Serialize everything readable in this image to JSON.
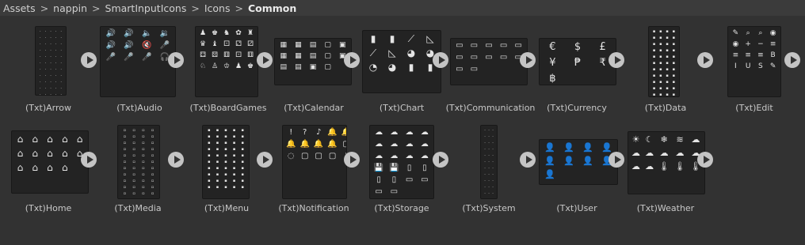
{
  "breadcrumb": [
    "Assets",
    "nappin",
    "SmartInputIcons",
    "Icons",
    "Common"
  ],
  "breadcrumb_separator": ">",
  "assets": [
    {
      "label": "(Txt)Arrow",
      "icon": "arrow-icon"
    },
    {
      "label": "(Txt)Audio",
      "icon": "audio-icon"
    },
    {
      "label": "(Txt)BoardGames",
      "icon": "board-games-icon"
    },
    {
      "label": "(Txt)Calendar",
      "icon": "calendar-icon"
    },
    {
      "label": "(Txt)Chart",
      "icon": "chart-icon"
    },
    {
      "label": "(Txt)Communication",
      "icon": "communication-icon"
    },
    {
      "label": "(Txt)Currency",
      "icon": "currency-icon"
    },
    {
      "label": "(Txt)Data",
      "icon": "data-icon"
    },
    {
      "label": "(Txt)Edit",
      "icon": "edit-icon"
    },
    {
      "label": "(Txt)Home",
      "icon": "home-icon"
    },
    {
      "label": "(Txt)Media",
      "icon": "media-icon"
    },
    {
      "label": "(Txt)Menu",
      "icon": "menu-icon"
    },
    {
      "label": "(Txt)Notification",
      "icon": "notification-icon"
    },
    {
      "label": "(Txt)Storage",
      "icon": "storage-icon"
    },
    {
      "label": "(Txt)System",
      "icon": "system-icon"
    },
    {
      "label": "(Txt)User",
      "icon": "user-icon"
    },
    {
      "label": "(Txt)Weather",
      "icon": "weather-icon"
    }
  ],
  "glyphs": {
    "arrow": "·",
    "audio": "🔊🔊🔈🔉🔊🔊🔇🎤🎤🎤🎤🎧",
    "boardgames": "♟♚♞✿♜♛♝⚀⚁⚂⚃⚄⚅⚀⚅♘♙♔",
    "calendar": "▦▦▤▢▣▦▦▤▢▣▤▤▣▢",
    "chart": "▮▮⟋◺⟋◺◕◕◔◕▮▮",
    "communication": "▭▭▭▭▭▭▭▭▭▭▭▭",
    "currency": "€$£¥₱₹฿",
    "data": "▪",
    "edit": "✎⌕⌕◉◉+−≡≡≡≡BIUS",
    "home": "⌂⌂⌂⌂⌂⌂⌂⌂⌂⌂⌂⌂⌂⌂",
    "media": "▫",
    "menu": "▪",
    "notification": "!?♪🔔🔔🔔🔔🔔🔔▢◌▢▢▢",
    "storage": "☁☁☁☁☁☁☁☁☁☁☁☁💾💾▯▯▯▯▭▭▭▭",
    "system": "·",
    "user": "👤👤👤👤👤👤👤👤👤",
    "weather": "☀☾❄≋☁☁☁☁☁☁☁☁🌡🌡🌡"
  }
}
